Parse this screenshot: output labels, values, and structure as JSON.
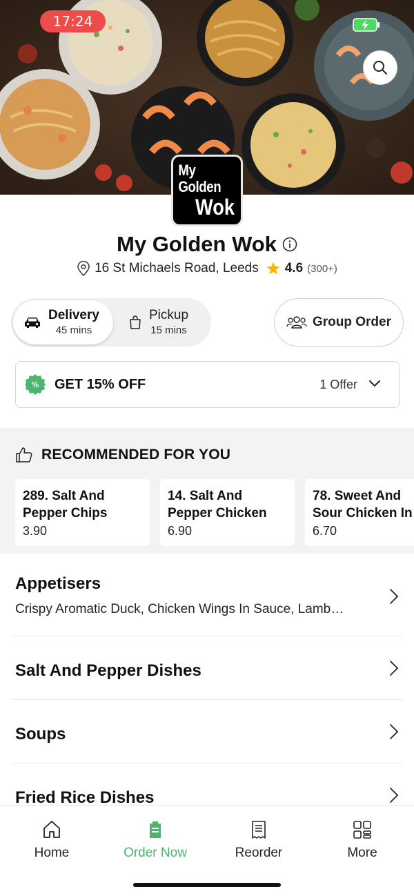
{
  "status_bar": {
    "time": "17:24"
  },
  "restaurant": {
    "logo_line1": "My Golden",
    "logo_line2": "Wok",
    "name": "My Golden Wok",
    "address": "16 St Michaels Road, Leeds",
    "rating": "4.6",
    "rating_count": "(300+)"
  },
  "order_mode": {
    "delivery": {
      "label": "Delivery",
      "time": "45 mins",
      "icon": "car-icon"
    },
    "pickup": {
      "label": "Pickup",
      "time": "15 mins",
      "icon": "bag-icon"
    },
    "group_order_label": "Group Order"
  },
  "offer": {
    "text": "GET 15% OFF",
    "count": "1 Offer"
  },
  "recommended": {
    "heading": "RECOMMENDED FOR YOU",
    "items": [
      {
        "name": "289. Salt And\nPepper Chips",
        "price": "3.90"
      },
      {
        "name": "14. Salt And\nPepper Chicken",
        "price": "6.90"
      },
      {
        "name": "78. Sweet And\nSour Chicken In",
        "price": "6.70"
      }
    ]
  },
  "categories": [
    {
      "name": "Appetisers",
      "description": "Crispy Aromatic Duck, Chicken Wings In Sauce, Lamb…"
    },
    {
      "name": "Salt And Pepper Dishes",
      "description": ""
    },
    {
      "name": "Soups",
      "description": ""
    },
    {
      "name": "Fried Rice Dishes",
      "description": ""
    }
  ],
  "bottom_nav": [
    {
      "label": "Home",
      "icon": "home-icon"
    },
    {
      "label": "Order Now",
      "icon": "order-icon"
    },
    {
      "label": "Reorder",
      "icon": "receipt-icon"
    },
    {
      "label": "More",
      "icon": "grid-icon"
    }
  ],
  "colors": {
    "accent": "#4cb56e",
    "time_pill": "#ee4b4b",
    "star": "#f5b800"
  }
}
